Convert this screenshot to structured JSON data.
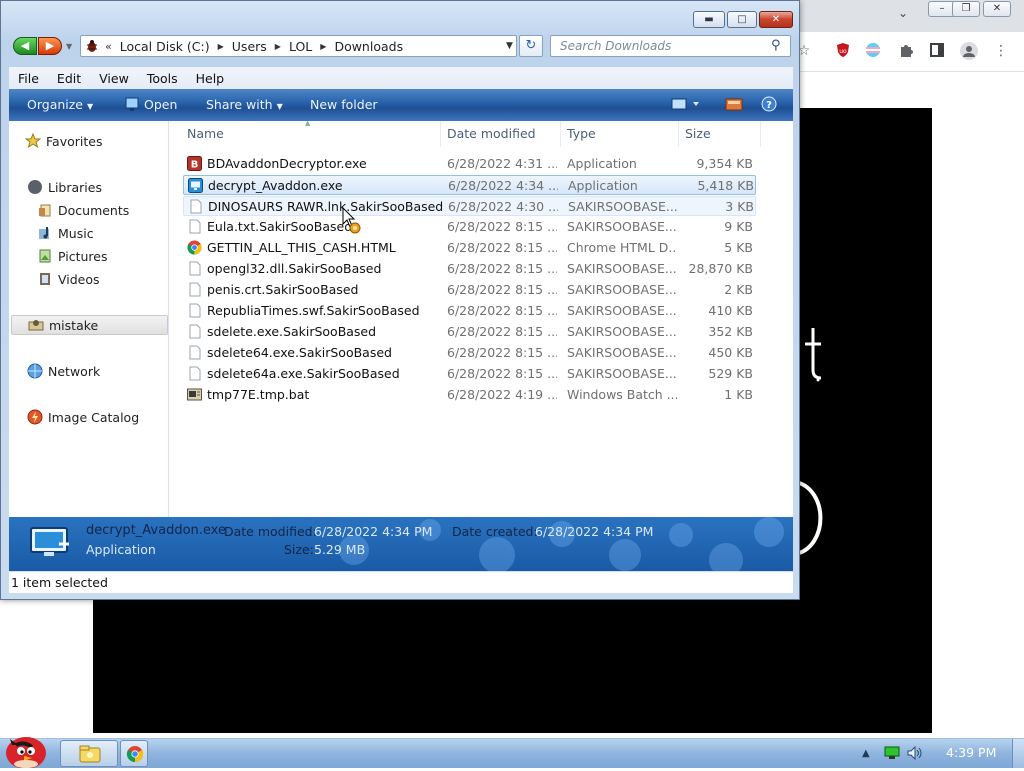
{
  "explorer": {
    "address": {
      "crumbs": [
        "Local Disk (C:)",
        "Users",
        "LOL",
        "Downloads"
      ]
    },
    "search_placeholder": "Search Downloads",
    "menu": [
      "File",
      "Edit",
      "View",
      "Tools",
      "Help"
    ],
    "commands": {
      "organize": "Organize",
      "open": "Open",
      "share_with": "Share with",
      "new_folder": "New folder"
    },
    "nav": {
      "favorites": "Favorites",
      "libraries": "Libraries",
      "documents": "Documents",
      "music": "Music",
      "pictures": "Pictures",
      "videos": "Videos",
      "mistake": "mistake",
      "network": "Network",
      "image_catalog": "Image Catalog"
    },
    "columns": {
      "name": "Name",
      "date": "Date modified",
      "type": "Type",
      "size": "Size"
    },
    "files": [
      {
        "name": "BDAvaddonDecryptor.exe",
        "date": "6/28/2022 4:31 ...",
        "type": "Application",
        "size": "9,354 KB",
        "icon": "bd-app-icon"
      },
      {
        "name": "decrypt_Avaddon.exe",
        "date": "6/28/2022 4:34 ...",
        "type": "Application",
        "size": "5,418 KB",
        "icon": "app-monitor-icon"
      },
      {
        "name": "DINOSAURS RAWR.lnk.SakirSooBased",
        "date": "6/28/2022 4:30 ...",
        "type": "SAKIRSOOBASE...",
        "size": "3 KB",
        "icon": "blank-file-icon"
      },
      {
        "name": "Eula.txt.SakirSooBased",
        "date": "6/28/2022 8:15 ...",
        "type": "SAKIRSOOBASE...",
        "size": "9 KB",
        "icon": "blank-file-icon"
      },
      {
        "name": "GETTIN_ALL_THIS_CASH.HTML",
        "date": "6/28/2022 8:15 ...",
        "type": "Chrome HTML D...",
        "size": "5 KB",
        "icon": "chrome-icon"
      },
      {
        "name": "opengl32.dll.SakirSooBased",
        "date": "6/28/2022 8:15 ...",
        "type": "SAKIRSOOBASE...",
        "size": "28,870 KB",
        "icon": "blank-file-icon"
      },
      {
        "name": "penis.crt.SakirSooBased",
        "date": "6/28/2022 8:15 ...",
        "type": "SAKIRSOOBASE...",
        "size": "2 KB",
        "icon": "blank-file-icon"
      },
      {
        "name": "RepubliaTimes.swf.SakirSooBased",
        "date": "6/28/2022 8:15 ...",
        "type": "SAKIRSOOBASE...",
        "size": "410 KB",
        "icon": "blank-file-icon"
      },
      {
        "name": "sdelete.exe.SakirSooBased",
        "date": "6/28/2022 8:15 ...",
        "type": "SAKIRSOOBASE...",
        "size": "352 KB",
        "icon": "blank-file-icon"
      },
      {
        "name": "sdelete64.exe.SakirSooBased",
        "date": "6/28/2022 8:15 ...",
        "type": "SAKIRSOOBASE...",
        "size": "450 KB",
        "icon": "blank-file-icon"
      },
      {
        "name": "sdelete64a.exe.SakirSooBased",
        "date": "6/28/2022 8:15 ...",
        "type": "SAKIRSOOBASE...",
        "size": "529 KB",
        "icon": "blank-file-icon"
      },
      {
        "name": "tmp77E.tmp.bat",
        "date": "6/28/2022 4:19 ...",
        "type": "Windows Batch ...",
        "size": "1 KB",
        "icon": "batch-file-icon"
      }
    ],
    "details": {
      "name": "decrypt_Avaddon.exe",
      "type": "Application",
      "date_modified_label": "Date modified:",
      "date_modified": "6/28/2022 4:34 PM",
      "date_created_label": "Date created:",
      "date_created": "6/28/2022 4:34 PM",
      "size_label": "Size:",
      "size": "5.29 MB"
    },
    "status": "1 item selected"
  },
  "taskbar": {
    "clock": "4:39 PM"
  },
  "colors": {
    "command_bar": "#2560a8",
    "selection": "#d6e7fb",
    "close_button": "#c8452d",
    "ublock_badge": "#c4161c"
  }
}
